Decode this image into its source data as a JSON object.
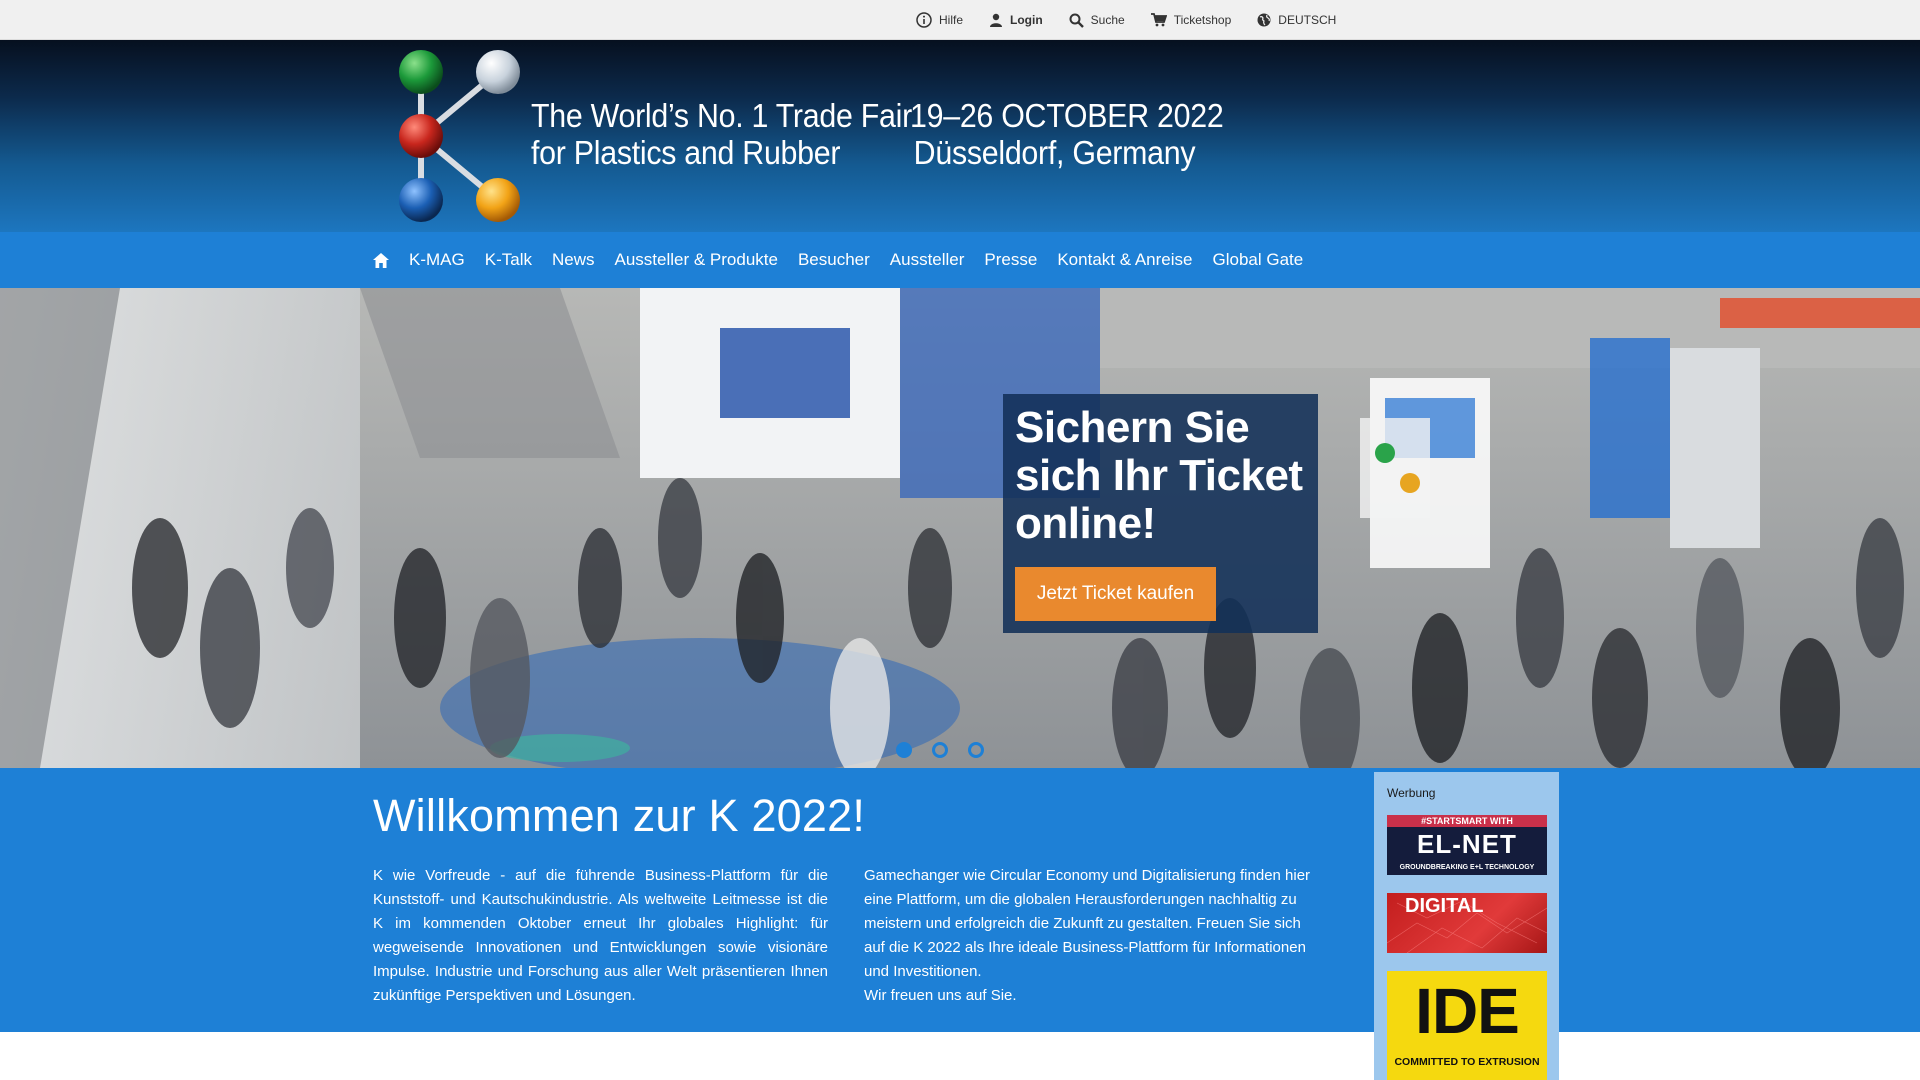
{
  "utility": {
    "help": "Hilfe",
    "login": "Login",
    "search": "Suche",
    "ticketshop": "Ticketshop",
    "language": "DEUTSCH"
  },
  "header": {
    "tagline_line1": "The World’s No. 1 Trade Fair",
    "tagline_line2": "for Plastics and Rubber",
    "dates": "19–26 OCTOBER 2022",
    "location": "Düsseldorf, Germany"
  },
  "nav": {
    "items": [
      "K-MAG",
      "K-Talk",
      "News",
      "Aussteller & Produkte",
      "Besucher",
      "Aussteller",
      "Presse",
      "Kontakt & Anreise",
      "Global Gate"
    ]
  },
  "hero": {
    "headline": "Sichern Sie sich Ihr Ticket online!",
    "button": "Jetzt Ticket kaufen",
    "slide_count": 3,
    "active_slide": 1
  },
  "content": {
    "title": "Willkommen zur K 2022!",
    "col_left": "K wie Vorfreude - auf die führende Business-Plattform für die Kunststoff- und Kautschukindustrie. Als weltweite Leitmesse ist die K im kommenden Oktober erneut Ihr globales Highlight: für wegweisende Innovationen und Entwicklungen sowie visionäre Impulse. Industrie und Forschung aus aller Welt präsentieren Ihnen zukünftige Perspektiven und Lösungen.",
    "col_right_p1": "Gamechanger wie Circular Economy und Digitalisierung finden hier eine Plattform, um die globalen Herausforderungen nachhaltig zu meistern und erfolgreich die Zukunft zu gestalten. Freuen Sie sich auf die K 2022 als Ihre ideale Business-Plattform für Informationen und Investitionen.",
    "col_right_p2": "Wir freuen uns auf Sie."
  },
  "ads": {
    "label": "Werbung",
    "ad1_top": "#STARTSMART WITH",
    "ad1_logo": "EL-NET",
    "ad1_bottom": "GROUNDBREAKING E+L TECHNOLOGY",
    "ad2_text": "DIGITAL",
    "ad3_logo": "IDE",
    "ad3_tagline": "COMMITTED TO EXTRUSION"
  },
  "colors": {
    "nav_blue": "#1e80d6",
    "cta_orange": "#e9892e",
    "ad_panel": "#9cc7ed"
  }
}
